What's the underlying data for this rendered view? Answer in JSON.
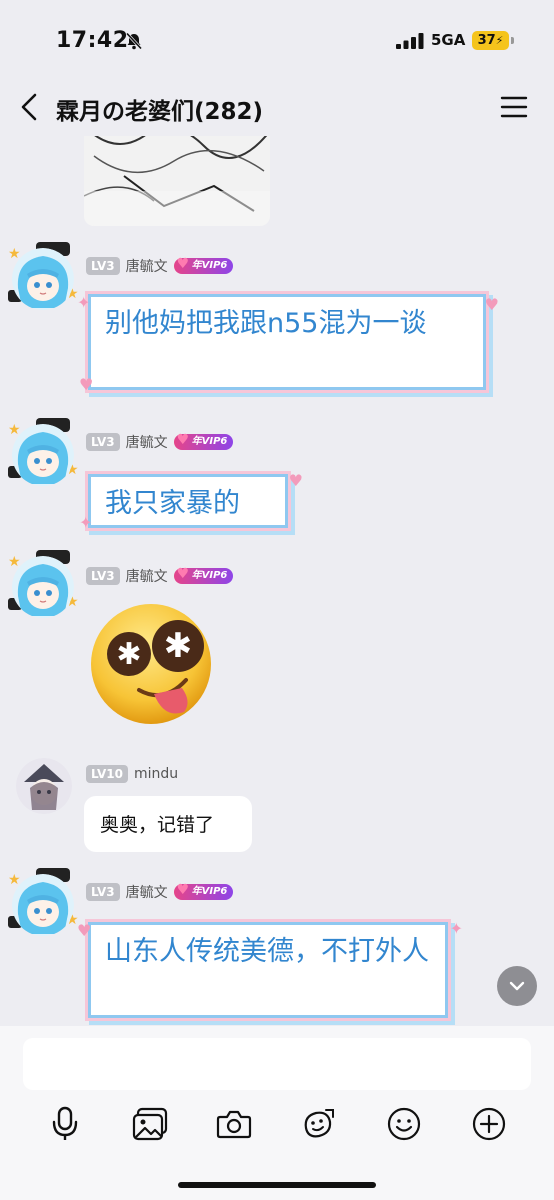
{
  "status_bar": {
    "time": "17:42",
    "network": "5GA",
    "battery": "37"
  },
  "header": {
    "title": "霖月の老婆们(282)"
  },
  "messages": [
    {
      "level": "LV3",
      "username": "唐毓文",
      "vip": "年VIP6",
      "text": "别他妈把我跟n55混为一谈"
    },
    {
      "level": "LV3",
      "username": "唐毓文",
      "vip": "年VIP6",
      "text": "我只家暴的"
    },
    {
      "level": "LV3",
      "username": "唐毓文",
      "vip": "年VIP6",
      "sticker": "dizzy-tongue-emoji"
    },
    {
      "level": "LV10",
      "username": "mindu",
      "text": "奥奥，记错了"
    },
    {
      "level": "LV3",
      "username": "唐毓文",
      "vip": "年VIP6",
      "text": "山东人传统美德，不打外人"
    }
  ],
  "input": {
    "value": ""
  },
  "toolbar_icons": [
    "microphone-icon",
    "image-icon",
    "camera-icon",
    "sticker-pen-icon",
    "emoji-icon",
    "plus-icon"
  ]
}
